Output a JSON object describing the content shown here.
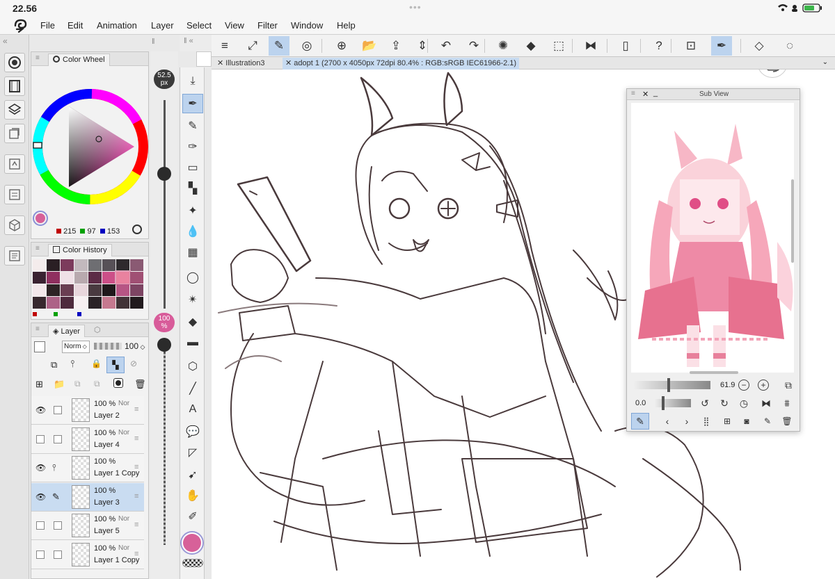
{
  "status_bar": {
    "time": "22.56",
    "right": "📶 ◉ 🔋"
  },
  "menu": [
    "File",
    "Edit",
    "Animation",
    "Layer",
    "Select",
    "View",
    "Filter",
    "Window",
    "Help"
  ],
  "color_wheel_panel": {
    "title": "Color Wheel",
    "rgb": {
      "r": "215",
      "g": "97",
      "b": "153"
    },
    "current_color": "#d76199",
    "legend": {
      "r": "#c00000",
      "g": "#00a000",
      "b": "#0000c0"
    }
  },
  "color_history_panel": {
    "title": "Color History",
    "swatches": [
      "#f4ecec",
      "#2a1f24",
      "#7c3b5c",
      "#c2b9bd",
      "#6e6e72",
      "#575157",
      "#2e2a2d",
      "#8a5a73",
      "#3a2231",
      "#8f2f5f",
      "#efe0e6",
      "#b8a9ae",
      "#5c2b46",
      "#cc4f88",
      "#e9829f",
      "#a05074",
      "#f2e7ea",
      "#2d2325",
      "#6a3e52",
      "#e8d6dc",
      "#493a40",
      "#1f181b",
      "#b65584",
      "#7d4563",
      "#37282e",
      "#ad6387",
      "#4e2a3d",
      "#f7f0f2",
      "#2a2226",
      "#c5798f",
      "#413236",
      "#211a1d"
    ]
  },
  "layer_panel": {
    "tab1": "Layer",
    "blend_mode": "Norm",
    "opacity": "100",
    "layers": [
      {
        "pct": "100 %",
        "blend": "Nor",
        "name": "Layer 2",
        "visible": true,
        "selected": false
      },
      {
        "pct": "100 %",
        "blend": "Nor",
        "name": "Layer 4",
        "visible": false,
        "selected": false
      },
      {
        "pct": "100 %",
        "blend": "",
        "name": "Layer 1 Copy",
        "visible": true,
        "selected": false
      },
      {
        "pct": "100 %",
        "blend": "",
        "name": "Layer 3",
        "visible": true,
        "selected": true
      },
      {
        "pct": "100 %",
        "blend": "Nor",
        "name": "Layer 5",
        "visible": false,
        "selected": false
      },
      {
        "pct": "100 %",
        "blend": "Nor",
        "name": "Layer 1 Copy",
        "visible": false,
        "selected": false
      }
    ]
  },
  "brush": {
    "size": "52.5",
    "size_unit": "px",
    "opacity": "100",
    "opacity_unit": "%"
  },
  "tabs": [
    {
      "label": "Illustration3",
      "active": false
    },
    {
      "label": "adopt 1  (2700 x 4050px 72dpi 80.4% : RGB:sRGB IEC61966-2.1)",
      "active": true
    }
  ],
  "subview": {
    "title": "Sub View",
    "zoom": "61.9",
    "rotation": "0.0"
  },
  "toolbar_icons": [
    "menu-icon",
    "fit-icon",
    "brush-icon",
    "spiral-icon",
    "new-icon",
    "open-icon",
    "save-icon",
    "stepper-icon",
    "undo-icon",
    "redo-icon",
    "loading-icon",
    "fill-icon",
    "transform-icon",
    "flip-icon",
    "phone-icon",
    "help-icon",
    "ruler-icon",
    "pen-icon",
    "eraser-icon",
    "lasso-icon"
  ],
  "tool_icons": [
    "down-arrow-icon",
    "pen-tool-icon",
    "pencil-icon",
    "ink-pen-icon",
    "eraser-tool-icon",
    "airbrush-icon",
    "sparkle-icon",
    "blend-icon",
    "mesh-icon",
    "lasso-tool-icon",
    "magic-wand-icon",
    "fill-tool-icon",
    "gradient-icon",
    "3d-icon",
    "line-icon",
    "text-icon",
    "balloon-icon",
    "frame-icon",
    "object-icon",
    "hand-icon",
    "eyedropper-icon"
  ]
}
